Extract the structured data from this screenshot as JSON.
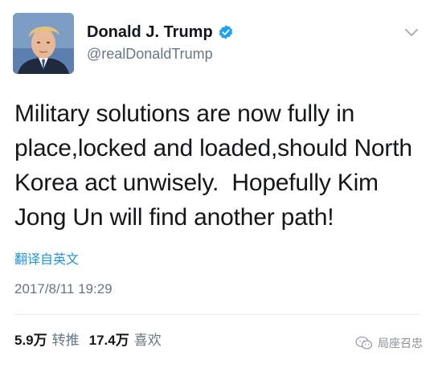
{
  "user": {
    "display_name": "Donald J. Trump",
    "handle": "@realDonaldTrump",
    "verified": true
  },
  "tweet": {
    "text": "Military solutions are now fully in place,locked and loaded,should North Korea act unwisely.  Hopefully Kim Jong Un will find another path!",
    "translate_label": "翻译自英文",
    "timestamp": "2017/8/11 19:29"
  },
  "stats": {
    "retweets_count": "5.9万",
    "retweets_label": "转推",
    "likes_count": "17.4万",
    "likes_label": "喜欢"
  },
  "watermark": {
    "text": "局座召忠"
  },
  "colors": {
    "link": "#1b95e0",
    "verified_badge": "#1da1f2",
    "secondary_text": "#657786"
  },
  "icons": {
    "verified": "verified-badge-icon",
    "menu": "chevron-down-icon",
    "watermark": "wechat-logo-icon"
  }
}
